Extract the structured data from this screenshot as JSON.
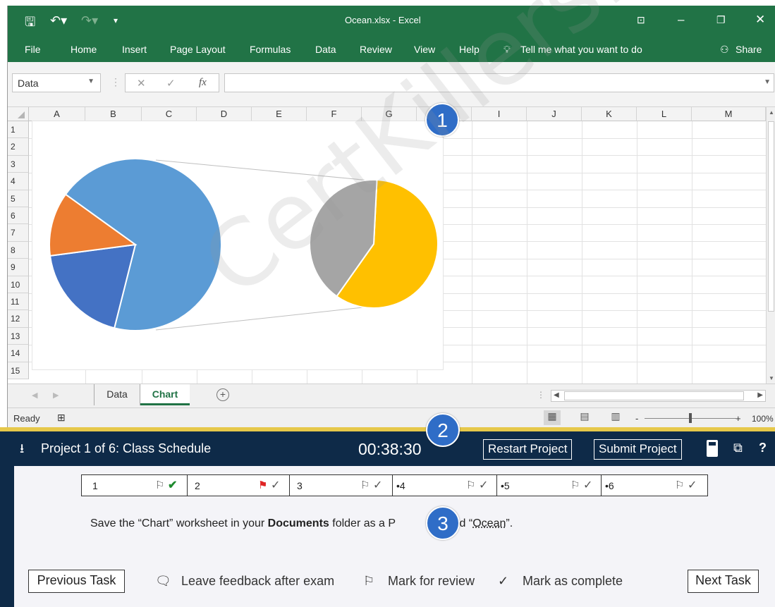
{
  "window": {
    "title": "Ocean.xlsx  -  Excel"
  },
  "ribbon": {
    "tabs": [
      "File",
      "Home",
      "Insert",
      "Page Layout",
      "Formulas",
      "Data",
      "Review",
      "View",
      "Help"
    ],
    "tell_me": "Tell me what you want to do",
    "share": "Share"
  },
  "formula_bar": {
    "name_box": "Data",
    "fx": "fx",
    "value": ""
  },
  "grid": {
    "columns": [
      "A",
      "B",
      "C",
      "D",
      "E",
      "F",
      "G",
      "H",
      "I",
      "J",
      "K",
      "L",
      "M"
    ],
    "rows": [
      "1",
      "2",
      "3",
      "4",
      "5",
      "6",
      "7",
      "8",
      "9",
      "10",
      "11",
      "12",
      "13",
      "14",
      "15"
    ]
  },
  "chart_data": {
    "type": "pie",
    "subtype": "pie-of-pie",
    "title": "",
    "main_pie": {
      "slices": [
        {
          "value": 69,
          "color": "#5b9bd5"
        },
        {
          "value": 19,
          "color": "#4472c4"
        },
        {
          "value": 12,
          "color": "#ed7d31"
        }
      ]
    },
    "secondary_pie": {
      "slices": [
        {
          "value": 59,
          "color": "#ffc000"
        },
        {
          "value": 41,
          "color": "#a5a5a5"
        }
      ]
    },
    "legend": "none"
  },
  "sheets": {
    "tabs": [
      "Data",
      "Chart"
    ],
    "active": "Chart"
  },
  "status": {
    "ready": "Ready",
    "zoom": "100%"
  },
  "exam": {
    "project_title": "Project 1 of 6: Class Schedule",
    "timer": "00:38:30",
    "restart": "Restart Project",
    "submit": "Submit Project",
    "tasks": [
      {
        "label": "1",
        "bullet": false,
        "flagged": false,
        "complete": true
      },
      {
        "label": "2",
        "bullet": false,
        "flagged": true,
        "complete": false
      },
      {
        "label": "3",
        "bullet": false,
        "flagged": false,
        "complete": false
      },
      {
        "label": "4",
        "bullet": true,
        "flagged": false,
        "complete": false
      },
      {
        "label": "5",
        "bullet": true,
        "flagged": false,
        "complete": false
      },
      {
        "label": "6",
        "bullet": true,
        "flagged": false,
        "complete": false
      }
    ],
    "instruction": {
      "part1": "Save the “Chart” worksheet in your ",
      "bold": "Documents",
      "part2": " folder as a P",
      "part3": " named “",
      "underlined": "Ocean",
      "part4": "”."
    },
    "previous": "Previous Task",
    "next": "Next Task",
    "feedback": "Leave feedback after exam",
    "mark_review": "Mark for review",
    "mark_complete": "Mark as complete"
  },
  "badges": [
    "1",
    "2",
    "3"
  ],
  "watermark": "CertKillers.net",
  "colors": {
    "excel_green": "#217346",
    "exam_navy": "#0e2a48",
    "badge_blue": "#2f6dc7",
    "flag_red": "#e02424",
    "check_green": "#1e8a2e"
  }
}
